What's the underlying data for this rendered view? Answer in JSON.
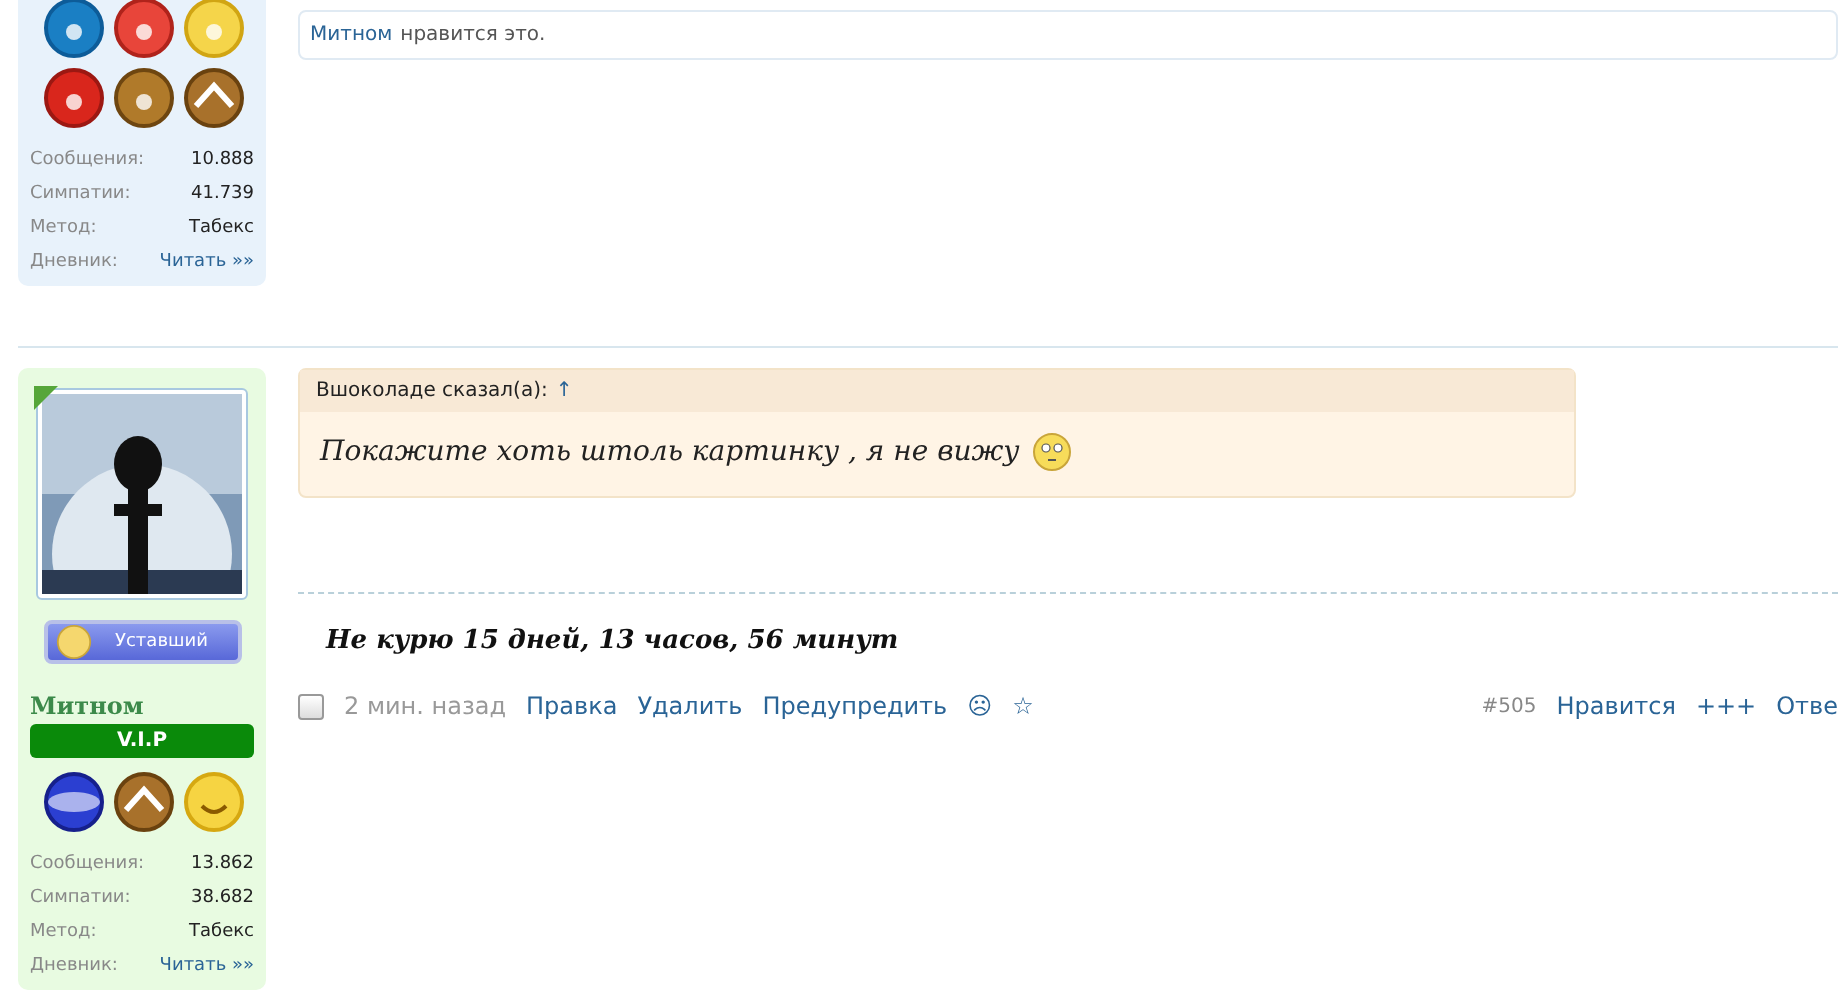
{
  "posts": [
    {
      "user": {
        "badges": [
          {
            "kind": "fork"
          },
          {
            "kind": "tomato"
          },
          {
            "kind": "medal"
          },
          {
            "kind": "apple"
          },
          {
            "kind": "muscle"
          },
          {
            "kind": "roof"
          }
        ],
        "stats": [
          {
            "label": "Сообщения:",
            "value": "10.888",
            "kind": "text"
          },
          {
            "label": "Симпатии:",
            "value": "41.739",
            "kind": "text"
          },
          {
            "label": "Метод:",
            "value": "Табекс",
            "kind": "text"
          },
          {
            "label": "Дневник:",
            "value": "Читать »»",
            "kind": "link"
          }
        ]
      },
      "likes": {
        "user": "Митном",
        "text": "нравится это."
      }
    },
    {
      "user": {
        "mood": "Уставший",
        "name": "Митном",
        "rank": "V.I.P",
        "badges": [
          {
            "kind": "globe"
          },
          {
            "kind": "roof"
          },
          {
            "kind": "smile"
          }
        ],
        "stats": [
          {
            "label": "Сообщения:",
            "value": "13.862",
            "kind": "text"
          },
          {
            "label": "Симпатии:",
            "value": "38.682",
            "kind": "text"
          },
          {
            "label": "Метод:",
            "value": "Табекс",
            "kind": "text"
          },
          {
            "label": "Дневник:",
            "value": "Читать »»",
            "kind": "link"
          }
        ]
      },
      "quote": {
        "author": "Вшоколаде сказал(а):",
        "arrow": "↑",
        "text": "Покажите хоть штоль картинку , я не вижу"
      },
      "signature": "Не курю 15 дней, 13 часов, 56 минут",
      "footer": {
        "checked": false,
        "time": "2 мин. назад",
        "actions": [
          "Правка",
          "Удалить",
          "Предупредить"
        ],
        "frown": "☹",
        "star": "☆",
        "number": "#505",
        "right": [
          "Нравится",
          "+++",
          "Отве"
        ]
      }
    }
  ]
}
